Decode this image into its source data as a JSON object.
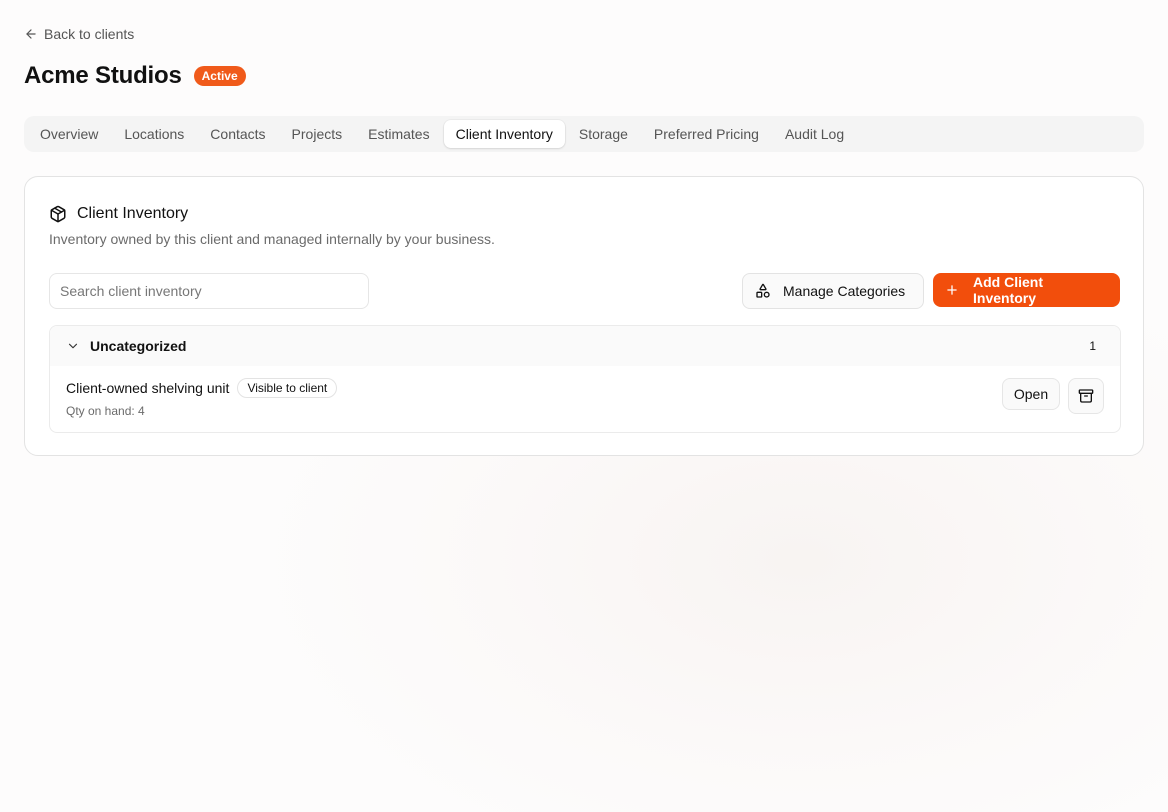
{
  "back_link": {
    "label": "Back to clients",
    "icon": "arrow-left-icon"
  },
  "client": {
    "name": "Acme Studios",
    "status": "Active",
    "status_color": "#f05a1a"
  },
  "tabs": [
    {
      "label": "Overview",
      "active": false
    },
    {
      "label": "Locations",
      "active": false
    },
    {
      "label": "Contacts",
      "active": false
    },
    {
      "label": "Projects",
      "active": false
    },
    {
      "label": "Estimates",
      "active": false
    },
    {
      "label": "Client Inventory",
      "active": true
    },
    {
      "label": "Storage",
      "active": false
    },
    {
      "label": "Preferred Pricing",
      "active": false
    },
    {
      "label": "Audit Log",
      "active": false
    }
  ],
  "inventory": {
    "icon": "package-icon",
    "title": "Client Inventory",
    "subtitle": "Inventory owned by this client and managed internally by your business.",
    "search": {
      "placeholder": "Search client inventory",
      "value": ""
    },
    "manage_button": {
      "label": "Manage Categories",
      "icon": "shapes-icon"
    },
    "add_button": {
      "label": "Add Client Inventory",
      "icon": "plus-icon",
      "color": "#f24e0c"
    },
    "groups": [
      {
        "name": "Uncategorized",
        "count": "1",
        "expanded": true,
        "items": [
          {
            "name": "Client-owned shelving unit",
            "badge": "Visible to client",
            "qty": "Qty on hand: 4",
            "open_label": "Open",
            "archive_icon": "archive-icon"
          }
        ]
      }
    ]
  }
}
